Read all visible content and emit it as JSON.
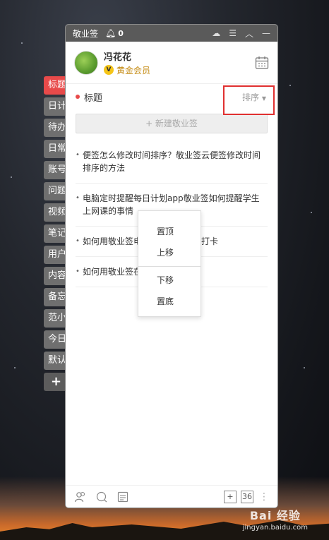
{
  "window": {
    "app_name": "敬业签",
    "notification_count": "0"
  },
  "user": {
    "name": "冯花花",
    "badge_letter": "V",
    "membership": "黄金会员"
  },
  "side_tabs": [
    {
      "label": "标题",
      "active": true
    },
    {
      "label": "日计"
    },
    {
      "label": "待办"
    },
    {
      "label": "日常"
    },
    {
      "label": "账号"
    },
    {
      "label": "问题"
    },
    {
      "label": "视频"
    },
    {
      "label": "笔记"
    },
    {
      "label": "用户"
    },
    {
      "label": "内容"
    },
    {
      "label": "备忘"
    },
    {
      "label": "范小"
    },
    {
      "label": "今日"
    },
    {
      "label": "默认"
    }
  ],
  "side_add_label": "+",
  "section": {
    "title": "标题",
    "sort_label": "排序"
  },
  "new_note_label": "+ 新建敬业签",
  "notes": [
    "便签怎么修改时间排序？敬业签云便签修改时间排序的方法",
    "电脑定时提醒每日计划app敬业签如何提醒学生上网课的事情",
    "如何用敬业签电脑定时提醒每天打卡",
    "如何用敬业签在      打卡提醒通知？"
  ],
  "context_menu": {
    "items_top": [
      "置顶",
      "上移"
    ],
    "items_bottom": [
      "下移",
      "置底"
    ]
  },
  "bottom_bar": {
    "count": "36",
    "add_label": "+"
  },
  "watermark": {
    "logo": "Bai 经验",
    "url": "jingyan.baidu.com"
  }
}
